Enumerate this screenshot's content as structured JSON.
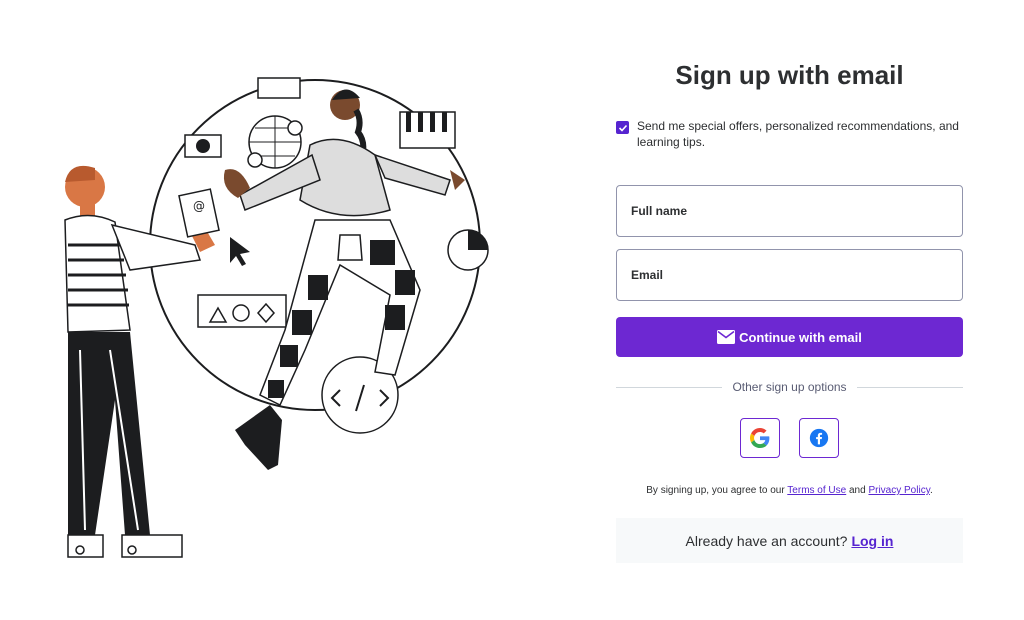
{
  "page": {
    "title": "Sign up with email"
  },
  "signup": {
    "optin_label": "Send me special offers, personalized recommendations, and learning tips.",
    "optin_checked": true,
    "fullname_placeholder": "Full name",
    "email_placeholder": "Email",
    "continue_label": "Continue with email",
    "other_options_label": "Other sign up options",
    "social_providers": [
      "google-icon",
      "facebook-icon"
    ],
    "terms_prefix": "By signing up, you agree to our",
    "terms_link": "Terms of Use",
    "terms_and": "and",
    "privacy_link": "Privacy Policy",
    "terms_suffix": ".",
    "login_prompt": "Already have an account?",
    "login_link": "Log in"
  },
  "colors": {
    "accent": "#6d28d2",
    "link": "#5624d0",
    "border": "#9194ac",
    "panel_bg": "#f7f9fa"
  }
}
